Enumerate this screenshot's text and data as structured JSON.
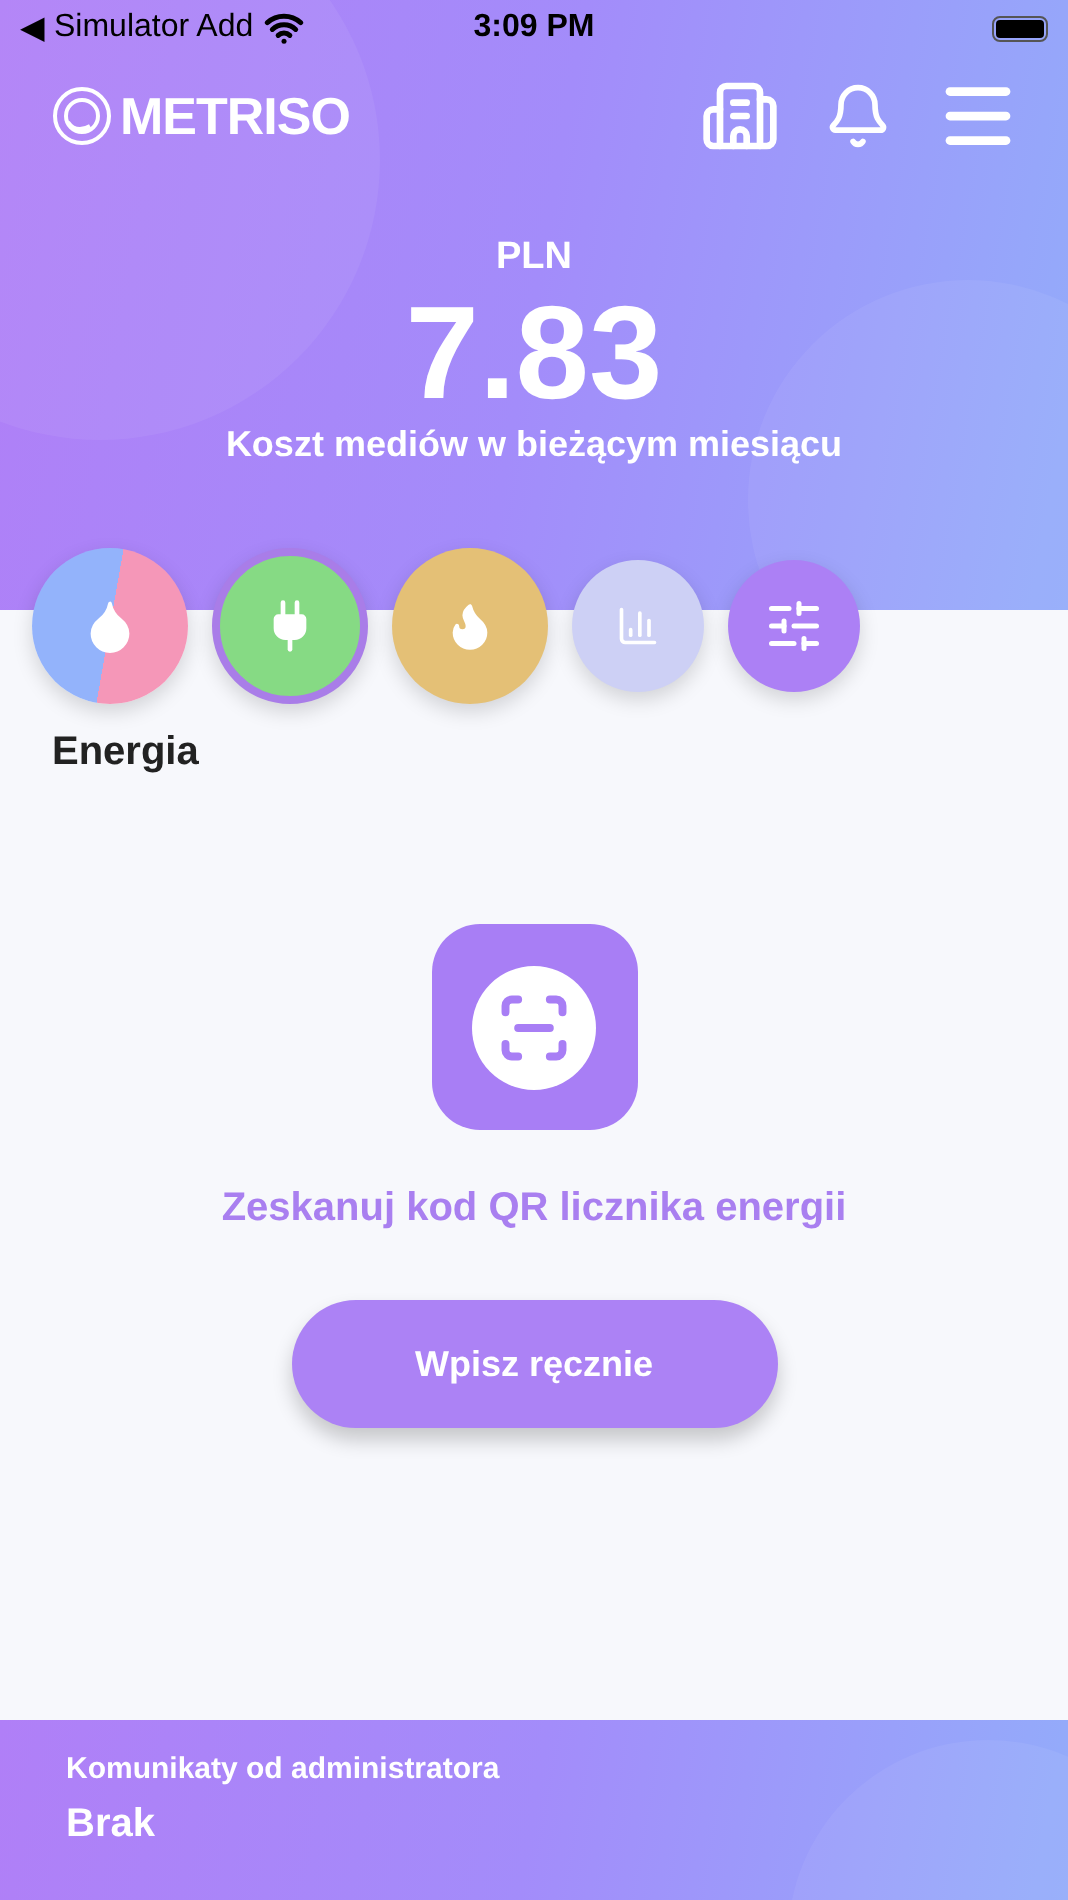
{
  "status_bar": {
    "back": "◀",
    "carrier": "Simulator Add",
    "time": "3:09 PM"
  },
  "header": {
    "logo": "METRISO",
    "currency": "PLN",
    "amount": "7.83",
    "caption": "Koszt mediów w bieżącym miesiącu"
  },
  "categories": [
    {
      "kind": "water",
      "selected": false
    },
    {
      "kind": "energy",
      "selected": true
    },
    {
      "kind": "gas",
      "selected": false
    },
    {
      "kind": "stats",
      "selected": false
    },
    {
      "kind": "settings",
      "selected": false
    }
  ],
  "section": {
    "title": "Energia",
    "scan_hint": "Zeskanuj kod QR licznika energii",
    "manual_button": "Wpisz ręcznie"
  },
  "footer": {
    "title": "Komunikaty od administratora",
    "message": "Brak"
  }
}
